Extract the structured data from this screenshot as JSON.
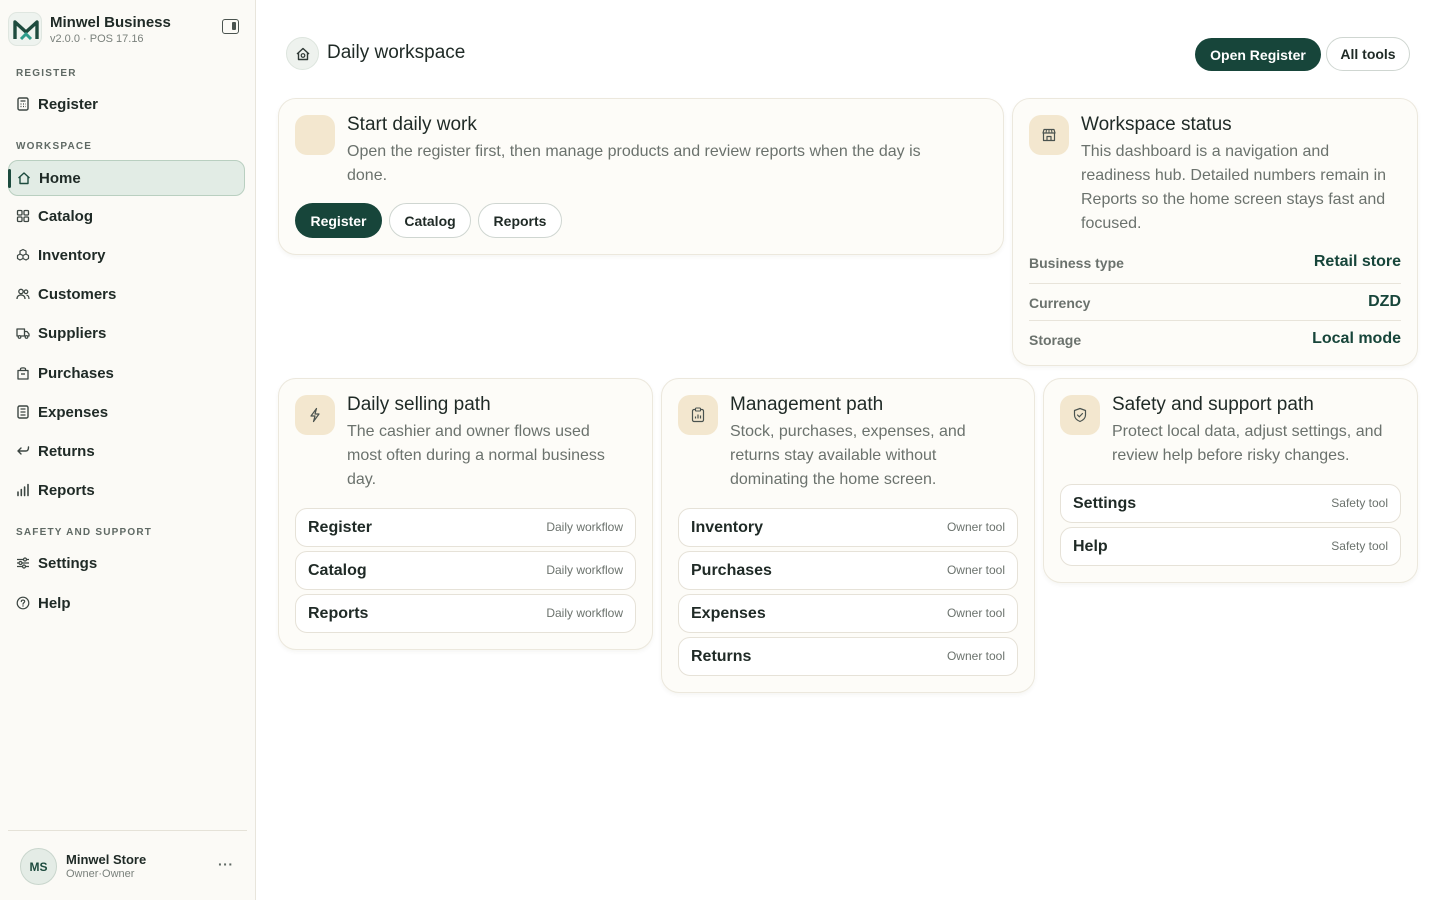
{
  "app": {
    "name": "Minwel Business",
    "version": "v2.0.0 · POS 17.16"
  },
  "sidebar": {
    "sections": [
      {
        "label": "REGISTER"
      },
      {
        "label": "WORKSPACE"
      },
      {
        "label": "SAFETY AND SUPPORT"
      }
    ],
    "items": [
      {
        "label": "Register",
        "icon": "register-icon"
      },
      {
        "label": "Home",
        "icon": "home-icon",
        "active": true
      },
      {
        "label": "Catalog",
        "icon": "catalog-icon"
      },
      {
        "label": "Inventory",
        "icon": "inventory-icon"
      },
      {
        "label": "Customers",
        "icon": "customers-icon"
      },
      {
        "label": "Suppliers",
        "icon": "suppliers-icon"
      },
      {
        "label": "Purchases",
        "icon": "purchases-icon"
      },
      {
        "label": "Expenses",
        "icon": "expenses-icon"
      },
      {
        "label": "Returns",
        "icon": "returns-icon"
      },
      {
        "label": "Reports",
        "icon": "reports-icon"
      },
      {
        "label": "Settings",
        "icon": "settings-icon"
      },
      {
        "label": "Help",
        "icon": "help-icon"
      }
    ],
    "account": {
      "initials": "MS",
      "name": "Minwel Store",
      "role": "Owner·Owner",
      "more": "···"
    }
  },
  "header": {
    "title": "Daily workspace",
    "primary_button": "Open Register",
    "secondary_button": "All tools"
  },
  "start_card": {
    "title": "Start daily work",
    "description": "Open the register first, then manage products and review reports when the day is done.",
    "buttons": [
      "Register",
      "Catalog",
      "Reports"
    ]
  },
  "status_card": {
    "title": "Workspace status",
    "description": "This dashboard is a navigation and readiness hub. Detailed numbers remain in Reports so the home screen stays fast and focused.",
    "rows": [
      {
        "key": "Business type",
        "value": "Retail store"
      },
      {
        "key": "Currency",
        "value": "DZD"
      },
      {
        "key": "Storage",
        "value": "Local mode"
      }
    ]
  },
  "selling_card": {
    "title": "Daily selling path",
    "description": "The cashier and owner flows used most often during a normal business day.",
    "rows": [
      {
        "label": "Register",
        "tag": "Daily workflow"
      },
      {
        "label": "Catalog",
        "tag": "Daily workflow"
      },
      {
        "label": "Reports",
        "tag": "Daily workflow"
      }
    ]
  },
  "management_card": {
    "title": "Management path",
    "description": "Stock, purchases, expenses, and returns stay available without dominating the home screen.",
    "rows": [
      {
        "label": "Inventory",
        "tag": "Owner tool"
      },
      {
        "label": "Purchases",
        "tag": "Owner tool"
      },
      {
        "label": "Expenses",
        "tag": "Owner tool"
      },
      {
        "label": "Returns",
        "tag": "Owner tool"
      }
    ]
  },
  "safety_card": {
    "title": "Safety and support path",
    "description": "Protect local data, adjust settings, and review help before risky changes.",
    "rows": [
      {
        "label": "Settings",
        "tag": "Safety tool"
      },
      {
        "label": "Help",
        "tag": "Safety tool"
      }
    ]
  },
  "colors": {
    "accent": "#17453a",
    "active_bg": "#e2ece5",
    "card_bg": "#fdfcf8",
    "icon_tile": "#f3e7cf",
    "sidebar_bg": "#fbfaf6"
  }
}
